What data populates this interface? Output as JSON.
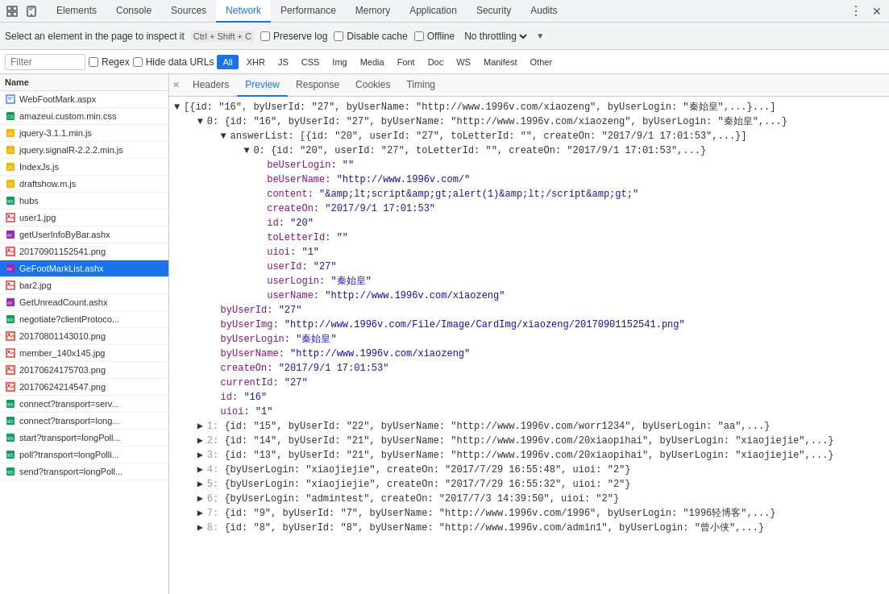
{
  "devtools": {
    "nav_tabs": [
      {
        "id": "elements",
        "label": "Elements",
        "active": false
      },
      {
        "id": "console",
        "label": "Console",
        "active": false
      },
      {
        "id": "sources",
        "label": "Sources",
        "active": false
      },
      {
        "id": "network",
        "label": "Network",
        "active": true
      },
      {
        "id": "performance",
        "label": "Performance",
        "active": false
      },
      {
        "id": "memory",
        "label": "Memory",
        "active": false
      },
      {
        "id": "application",
        "label": "Application",
        "active": false
      },
      {
        "id": "security",
        "label": "Security",
        "active": false
      },
      {
        "id": "audits",
        "label": "Audits",
        "active": false
      }
    ],
    "toolbar2": {
      "inspect_text": "Select an element in the page to inspect it",
      "shortcut": "Ctrl + Shift + C",
      "preserve_log": "Preserve log",
      "disable_cache": "Disable cache",
      "offline": "Offline",
      "no_throttling": "No throttling"
    },
    "filter_bar": {
      "placeholder": "Filter",
      "regex_label": "Regex",
      "hide_data_urls": "Hide data URLs",
      "all_label": "All",
      "xhr_label": "XHR",
      "js_label": "JS",
      "css_label": "CSS",
      "img_label": "Img",
      "media_label": "Media",
      "font_label": "Font",
      "doc_label": "Doc",
      "ws_label": "WS",
      "manifest_label": "Manifest",
      "other_label": "Other"
    },
    "file_list": {
      "header": "Name",
      "files": [
        {
          "name": "WebFootMark.aspx",
          "type": "page",
          "selected": false
        },
        {
          "name": "amazeui.custom.min.css",
          "type": "css",
          "selected": false
        },
        {
          "name": "jquery-3.1.1.min.js",
          "type": "js",
          "selected": false
        },
        {
          "name": "jquery.signalR-2.2.2.min.js",
          "type": "js",
          "selected": false
        },
        {
          "name": "IndexJs.js",
          "type": "js",
          "selected": false
        },
        {
          "name": "draftshow.m.js",
          "type": "js",
          "selected": false
        },
        {
          "name": "hubs",
          "type": "ws",
          "selected": false
        },
        {
          "name": "user1.jpg",
          "type": "img",
          "selected": false
        },
        {
          "name": "getUserInfoByBar.ashx",
          "type": "ashx",
          "selected": false
        },
        {
          "name": "20170901152541.png",
          "type": "png",
          "selected": false
        },
        {
          "name": "GeFootMarkList.ashx",
          "type": "ashx",
          "selected": true
        },
        {
          "name": "bar2.jpg",
          "type": "img",
          "selected": false
        },
        {
          "name": "GetUnreadCount.ashx",
          "type": "ashx",
          "selected": false
        },
        {
          "name": "negotiate?clientProtoco...",
          "type": "ws",
          "selected": false
        },
        {
          "name": "20170801143010.png",
          "type": "png",
          "selected": false
        },
        {
          "name": "member_140x145.jpg",
          "type": "img",
          "selected": false
        },
        {
          "name": "20170624175703.png",
          "type": "png",
          "selected": false
        },
        {
          "name": "20170624214547.png",
          "type": "png",
          "selected": false
        },
        {
          "name": "connect?transport=serv...",
          "type": "ws",
          "selected": false
        },
        {
          "name": "connect?transport=long...",
          "type": "ws",
          "selected": false
        },
        {
          "name": "start?transport=longPoll...",
          "type": "ws",
          "selected": false
        },
        {
          "name": "poll?transport=longPolli...",
          "type": "ws",
          "selected": false
        },
        {
          "name": "send?transport=longPoll...",
          "type": "ws",
          "selected": false
        }
      ]
    },
    "preview": {
      "tabs": [
        {
          "id": "headers",
          "label": "Headers",
          "active": false
        },
        {
          "id": "preview",
          "label": "Preview",
          "active": true
        },
        {
          "id": "response",
          "label": "Response",
          "active": false
        },
        {
          "id": "cookies",
          "label": "Cookies",
          "active": false
        },
        {
          "id": "timing",
          "label": "Timing",
          "active": false
        }
      ],
      "json_content": [
        {
          "indent": 0,
          "type": "expand",
          "arrow": "▼",
          "text": "[{id: \"16\", byUserId: \"27\", byUserName: \"http://www.1996v.com/xiaozeng\", byUserLogin: \"秦始皇\",...}...]"
        },
        {
          "indent": 1,
          "type": "expand",
          "arrow": "▼",
          "text": "0: {id: \"16\", byUserId: \"27\", byUserName: \"http://www.1996v.com/xiaozeng\", byUserLogin: \"秦始皇\",...}"
        },
        {
          "indent": 2,
          "type": "expand",
          "arrow": "▼",
          "text": "answerList: [{id: \"20\", userId: \"27\", toLetterId: \"\", createOn: \"2017/9/1 17:01:53\",...}]"
        },
        {
          "indent": 3,
          "type": "expand",
          "arrow": "▼",
          "text": "0: {id: \"20\", userId: \"27\", toLetterId: \"\", createOn: \"2017/9/1 17:01:53\",...}"
        },
        {
          "indent": 4,
          "type": "key-value",
          "key": "beUserLogin",
          "value": "\"\""
        },
        {
          "indent": 4,
          "type": "key-url",
          "key": "beUserName",
          "value": "\"http://www.1996v.com/\""
        },
        {
          "indent": 4,
          "type": "key-value",
          "key": "content",
          "value": "\"&amp;lt;script&amp;gt;alert(1)&amp;lt;/script&amp;gt;\""
        },
        {
          "indent": 4,
          "type": "key-value",
          "key": "createOn",
          "value": "\"2017/9/1 17:01:53\""
        },
        {
          "indent": 4,
          "type": "key-value",
          "key": "id",
          "value": "\"20\""
        },
        {
          "indent": 4,
          "type": "key-value",
          "key": "toLetterId",
          "value": "\"\""
        },
        {
          "indent": 4,
          "type": "key-value",
          "key": "uioi",
          "value": "\"1\""
        },
        {
          "indent": 4,
          "type": "key-value",
          "key": "userId",
          "value": "\"27\""
        },
        {
          "indent": 4,
          "type": "key-cn",
          "key": "userLogin",
          "value": "\"秦始皇\""
        },
        {
          "indent": 4,
          "type": "key-url",
          "key": "userName",
          "value": "\"http://www.1996v.com/xiaozeng\""
        },
        {
          "indent": 2,
          "type": "key-value",
          "key": "byUserId",
          "value": "\"27\""
        },
        {
          "indent": 2,
          "type": "key-url",
          "key": "byUserImg",
          "value": "\"http://www.1996v.com/File/Image/CardImg/xiaozeng/20170901152541.png\""
        },
        {
          "indent": 2,
          "type": "key-cn",
          "key": "byUserLogin",
          "value": "\"秦始皇\""
        },
        {
          "indent": 2,
          "type": "key-url",
          "key": "byUserName",
          "value": "\"http://www.1996v.com/xiaozeng\""
        },
        {
          "indent": 2,
          "type": "key-value",
          "key": "createOn",
          "value": "\"2017/9/1 17:01:53\""
        },
        {
          "indent": 2,
          "type": "key-value",
          "key": "currentId",
          "value": "\"27\""
        },
        {
          "indent": 2,
          "type": "key-value",
          "key": "id",
          "value": "\"16\""
        },
        {
          "indent": 2,
          "type": "key-value",
          "key": "uioi",
          "value": "\"1\""
        },
        {
          "indent": 1,
          "type": "collapsed",
          "arrow": "▶",
          "num": "1",
          "text": "{id: \"15\", byUserId: \"22\", byUserName: \"http://www.1996v.com/worr1234\", byUserLogin: \"aa\",...}"
        },
        {
          "indent": 1,
          "type": "collapsed",
          "arrow": "▶",
          "num": "2",
          "text": "{id: \"14\", byUserId: \"21\", byUserName: \"http://www.1996v.com/20xiaopihai\", byUserLogin: \"xiaojiejie\",...}"
        },
        {
          "indent": 1,
          "type": "collapsed",
          "arrow": "▶",
          "num": "3",
          "text": "{id: \"13\", byUserId: \"21\", byUserName: \"http://www.1996v.com/20xiaopihai\", byUserLogin: \"xiaojiejie\",...}"
        },
        {
          "indent": 1,
          "type": "collapsed",
          "arrow": "▶",
          "num": "4",
          "text": "{byUserLogin: \"xiaojiejie\", createOn: \"2017/7/29 16:55:48\", uioi: \"2\"}"
        },
        {
          "indent": 1,
          "type": "collapsed",
          "arrow": "▶",
          "num": "5",
          "text": "{byUserLogin: \"xiaojiejie\", createOn: \"2017/7/29 16:55:32\", uioi: \"2\"}"
        },
        {
          "indent": 1,
          "type": "collapsed",
          "arrow": "▶",
          "num": "6",
          "text": "{byUserLogin: \"admintest\", createOn: \"2017/7/3 14:39:50\", uioi: \"2\"}"
        },
        {
          "indent": 1,
          "type": "collapsed",
          "arrow": "▶",
          "num": "7",
          "text": "{id: \"9\", byUserId: \"7\", byUserName: \"http://www.1996v.com/1996\", byUserLogin: \"1996轻博客\",...}"
        },
        {
          "indent": 1,
          "type": "collapsed",
          "arrow": "▶",
          "num": "8",
          "text": "{id: \"8\", byUserId: \"8\", byUserName: \"http://www.1996v.com/admin1\", byUserLogin: \"曾小侠\",...}"
        }
      ]
    }
  }
}
